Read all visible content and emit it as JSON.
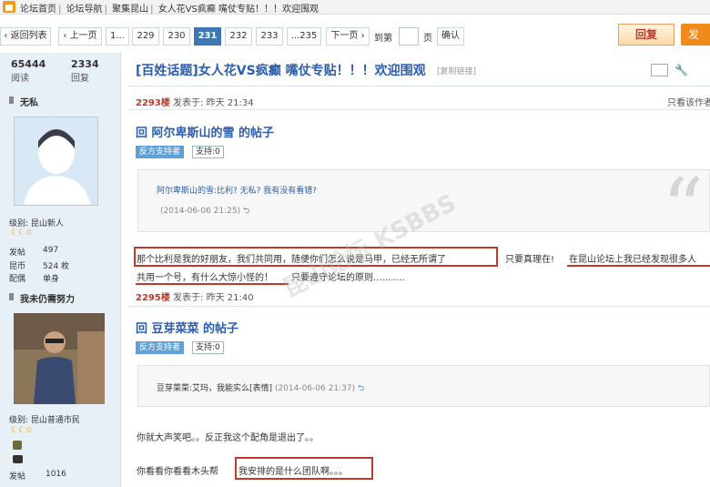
{
  "breadcrumb": [
    "论坛首页",
    "论坛导航",
    "聚集昆山",
    "女人花VS疯癫 嘴仗专贴！！！欢迎围观"
  ],
  "pager": {
    "back": "返回列表",
    "prev": "上一页",
    "pages": [
      "1...",
      "229",
      "230",
      "231",
      "232",
      "233",
      "...235"
    ],
    "current": "231",
    "next": "下一页",
    "goto_label": "到第",
    "page_unit": "页",
    "confirm": "确认"
  },
  "actions": {
    "reply": "回复",
    "post": "发"
  },
  "stats": {
    "views": "65444",
    "views_label": "阅读",
    "replies": "2334",
    "replies_label": "回复"
  },
  "thread": {
    "title": "[百姓话题]女人花VS疯癫 嘴仗专贴！！！欢迎围观",
    "copy_link": "[复制链接]",
    "only_author": "只看该作者"
  },
  "users": [
    {
      "name": "无私",
      "level": "级别: 昆山新人",
      "posts_label": "发帖",
      "posts": "497",
      "coins_label": "昆币",
      "coins": "524 枚",
      "partner_label": "配偶",
      "partner": "单身"
    },
    {
      "name": "我未仍需努力",
      "level": "级别: 昆山普通市民",
      "posts_label": "发帖",
      "posts": "1016"
    }
  ],
  "posts": [
    {
      "floor": "2293楼",
      "time": "发表于: 昨天 21:34",
      "title": "回 阿尔卑斯山的雪 的帖子",
      "tag": "反方支持者",
      "support": "支持:0",
      "quote_text": "阿尔卑斯山的雪:比利? 无私? 我有没有看错?",
      "quote_time": "(2014-06-06 21:25)",
      "line1_a": "那个比利是我的好朋友，我们共同用，随便你们怎么说是马甲，已经无所谓了",
      "line1_b": "只要真理在!",
      "line1_c": "在昆山论坛上我已经发现很多人",
      "line2_a": "共用一个号，有什么大惊小怪的！",
      "line2_b": "只要遵守论坛的原则..........."
    },
    {
      "floor": "2295楼",
      "time": "发表于: 昨天 21:40",
      "title": "回 豆芽菜菜 的帖子",
      "tag": "反方支持者",
      "support": "支持:0",
      "quote_text": "豆芽菜菜:艾玛，我能实么[表情]",
      "quote_time": "(2014-06-06 21:37)",
      "line1": "你就大声笑吧。。反正我这个配角是退出了。。",
      "line2_a": "你看看你看看木头帮",
      "line2_b": "我安排的是什么团队啊。。。"
    }
  ],
  "watermark": "昆山论坛 KSBBS"
}
